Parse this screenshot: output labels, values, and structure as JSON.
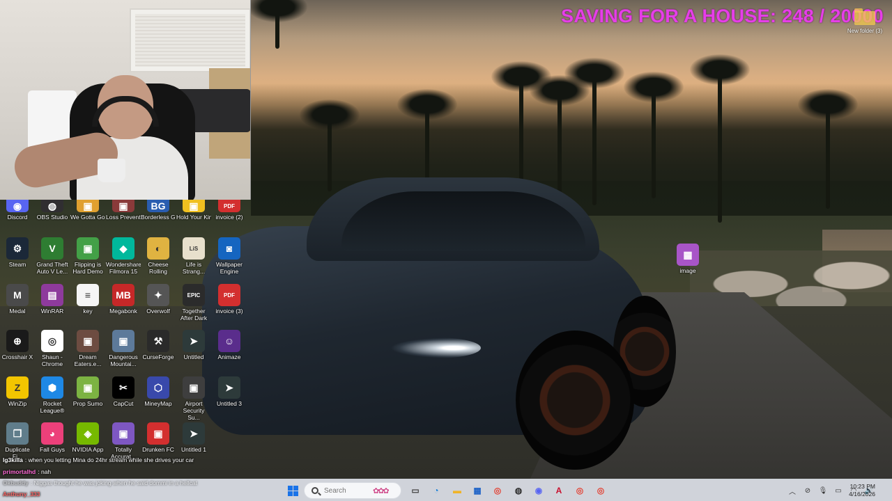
{
  "banner": {
    "text": "SAVING FOR A HOUSE: 248 / 20000",
    "color": "#e63ee8"
  },
  "top_right_folder": {
    "label": "New folder (3)"
  },
  "desktop": {
    "icons": [
      {
        "id": "discord",
        "label": "Discord",
        "icon": "discord-icon",
        "color": "#5865f2"
      },
      {
        "id": "obs",
        "label": "OBS Studio",
        "icon": "obs-icon",
        "color": "#302e31"
      },
      {
        "id": "wegotta",
        "label": "We Gotta Go Demo",
        "icon": "game-icon",
        "color": "#e0a030"
      },
      {
        "id": "loss",
        "label": "Loss Preventi...",
        "icon": "game-icon",
        "color": "#8a3a3a"
      },
      {
        "id": "borderless",
        "label": "Borderless Gaming",
        "icon": "borderless-icon",
        "color": "#2a5db0"
      },
      {
        "id": "holdyour",
        "label": "Hold Your King Demo",
        "icon": "game-icon",
        "color": "#f0c020"
      },
      {
        "id": "invoice2",
        "label": "invoice (2)",
        "icon": "pdf-icon",
        "color": "#d32f2f"
      },
      {
        "id": "steam",
        "label": "Steam",
        "icon": "steam-icon",
        "color": "#1b2838"
      },
      {
        "id": "gta",
        "label": "Grand Theft Auto V Le...",
        "icon": "gta-icon",
        "color": "#2e7d32"
      },
      {
        "id": "flipping",
        "label": "Flipping is Hard Demo",
        "icon": "game-icon",
        "color": "#43a047"
      },
      {
        "id": "filmora",
        "label": "Wondershare Filmora 15",
        "icon": "filmora-icon",
        "color": "#00b89c"
      },
      {
        "id": "cheese",
        "label": "Cheese Rolling",
        "icon": "cheese-icon",
        "color": "#e0b341"
      },
      {
        "id": "lifestrange",
        "label": "Life is Strang...",
        "icon": "life-is-strange-icon",
        "color": "#e8e0cc"
      },
      {
        "id": "wallpaper",
        "label": "Wallpaper Engine",
        "icon": "wallpaper-engine-icon",
        "color": "#1565c0"
      },
      {
        "id": "medal",
        "label": "Medal",
        "icon": "medal-icon",
        "color": "#4a4a4a"
      },
      {
        "id": "winrar",
        "label": "WinRAR",
        "icon": "winrar-icon",
        "color": "#8e3a9c"
      },
      {
        "id": "key",
        "label": "key",
        "icon": "text-file-icon",
        "color": "#f5f5f5"
      },
      {
        "id": "megabonk",
        "label": "Megabonk",
        "icon": "megabonk-icon",
        "color": "#c62828"
      },
      {
        "id": "overwolf",
        "label": "Overwolf",
        "icon": "overwolf-icon",
        "color": "#555555"
      },
      {
        "id": "together",
        "label": "Together After Dark",
        "icon": "epic-games-icon",
        "color": "#2b2b2b"
      },
      {
        "id": "invoice3",
        "label": "invoice (3)",
        "icon": "pdf-icon",
        "color": "#d32f2f"
      },
      {
        "id": "crosshair",
        "label": "Crosshair X",
        "icon": "crosshair-icon",
        "color": "#1a1a1a"
      },
      {
        "id": "chrome",
        "label": "Shaun - Chrome",
        "icon": "chrome-icon",
        "color": "#ffffff"
      },
      {
        "id": "dream",
        "label": "Dream Eaters.e...",
        "icon": "game-icon",
        "color": "#6d4c41"
      },
      {
        "id": "dangerous",
        "label": "Dangerous Mountai...",
        "icon": "game-icon",
        "color": "#5d7a9a"
      },
      {
        "id": "curseforge",
        "label": "CurseForge",
        "icon": "curseforge-icon",
        "color": "#2a2a2a"
      },
      {
        "id": "untitled",
        "label": "Untitled",
        "icon": "shortcut-icon",
        "color": "#2d3a3a"
      },
      {
        "id": "animaze",
        "label": "Animaze",
        "icon": "animaze-icon",
        "color": "#5a2d8c"
      },
      {
        "id": "winzip",
        "label": "WinZip",
        "icon": "winzip-icon",
        "color": "#f2c500"
      },
      {
        "id": "rocket",
        "label": "Rocket League®",
        "icon": "rocket-league-icon",
        "color": "#1e88e5"
      },
      {
        "id": "propsumo",
        "label": "Prop Sumo",
        "icon": "game-icon",
        "color": "#7cb342"
      },
      {
        "id": "capcut",
        "label": "CapCut",
        "icon": "capcut-icon",
        "color": "#000000"
      },
      {
        "id": "mineymap",
        "label": "MineyMap",
        "icon": "mineymap-icon",
        "color": "#3949ab"
      },
      {
        "id": "airport",
        "label": "Airport Security Su...",
        "icon": "game-icon",
        "color": "#3e3e3e"
      },
      {
        "id": "untitled3",
        "label": "Untitled 3",
        "icon": "shortcut-icon",
        "color": "#2d3a3a"
      },
      {
        "id": "duplicate",
        "label": "Duplicate Fi...",
        "icon": "duplicate-icon",
        "color": "#607d8b"
      },
      {
        "id": "fallguys",
        "label": "Fall Guys",
        "icon": "fall-guys-icon",
        "color": "#ec407a"
      },
      {
        "id": "nvidia",
        "label": "NVIDIA App",
        "icon": "nvidia-icon",
        "color": "#76b900"
      },
      {
        "id": "totally",
        "label": "Totally Accurat...",
        "icon": "game-icon",
        "color": "#7e57c2"
      },
      {
        "id": "drunken",
        "label": "Drunken FC",
        "icon": "game-icon",
        "color": "#d32f2f"
      },
      {
        "id": "untitled1",
        "label": "Untitled 1",
        "icon": "shortcut-icon",
        "color": "#2d3a3a"
      },
      {
        "id": "image",
        "label": "image",
        "icon": "image-file-icon",
        "color": "#a855c7"
      }
    ]
  },
  "chat": [
    {
      "user": "lg3killa",
      "message": "when you letting Mina do 24hr stream while she drives your car",
      "color": "#ffffff"
    },
    {
      "user": "primortalhd",
      "message": "nah",
      "color": "#ff6bd6"
    },
    {
      "user": "Okbuddy",
      "message": "Niggas thought he was joking when he said dommi in a hellcat",
      "color": "#b0b0b0"
    },
    {
      "user": "Anthuny_333",
      "message": "",
      "color": "#ff6b6b"
    }
  ],
  "taskbar": {
    "search_placeholder": "Search",
    "apps": [
      {
        "id": "file-view",
        "icon": "task-view-icon"
      },
      {
        "id": "edge",
        "icon": "edge-icon"
      },
      {
        "id": "explorer",
        "icon": "file-explorer-icon"
      },
      {
        "id": "store",
        "icon": "store-icon"
      },
      {
        "id": "chrome",
        "icon": "chrome-icon"
      },
      {
        "id": "obs",
        "icon": "obs-icon"
      },
      {
        "id": "discord",
        "icon": "discord-icon"
      },
      {
        "id": "acrobat",
        "icon": "acrobat-icon"
      },
      {
        "id": "chrome2",
        "icon": "chrome-icon"
      },
      {
        "id": "chrome3",
        "icon": "chrome-icon"
      }
    ],
    "tray_icons": [
      "chevron-up-icon",
      "network-icon",
      "microphone-icon",
      "display-icon",
      "wifi-icon",
      "volume-icon"
    ],
    "clock": {
      "time": "10:23 PM",
      "date": "4/16/2026"
    }
  }
}
